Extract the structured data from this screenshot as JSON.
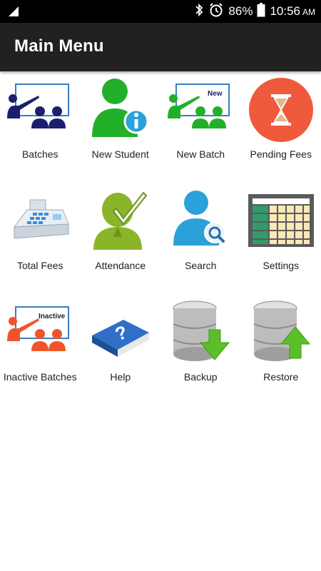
{
  "status_bar": {
    "battery": "86%",
    "time": "10:56",
    "ampm": "AM",
    "icons": [
      "signal-icon",
      "bluetooth-icon",
      "alarm-icon",
      "battery-icon"
    ]
  },
  "app_bar": {
    "title": "Main Menu"
  },
  "menu": [
    {
      "label": "Batches",
      "icon": "batches-icon"
    },
    {
      "label": "New Student",
      "icon": "new-student-icon"
    },
    {
      "label": "New Batch",
      "icon": "new-batch-icon",
      "badge": "New"
    },
    {
      "label": "Pending Fees",
      "icon": "hourglass-icon"
    },
    {
      "label": "Total Fees",
      "icon": "cash-register-icon"
    },
    {
      "label": "Attendance",
      "icon": "attendance-icon"
    },
    {
      "label": "Search",
      "icon": "search-user-icon"
    },
    {
      "label": "Settings",
      "icon": "spreadsheet-icon"
    },
    {
      "label": "Inactive Batches",
      "icon": "inactive-batches-icon",
      "badge": "Inactive"
    },
    {
      "label": "Help",
      "icon": "help-book-icon"
    },
    {
      "label": "Backup",
      "icon": "database-download-icon"
    },
    {
      "label": "Restore",
      "icon": "database-upload-icon"
    }
  ],
  "colors": {
    "status_bar": "#000000",
    "app_bar": "#212121",
    "navy": "#1a1f6e",
    "green": "#22b02a",
    "orange": "#f0552a",
    "teal": "#2aa1d8"
  }
}
